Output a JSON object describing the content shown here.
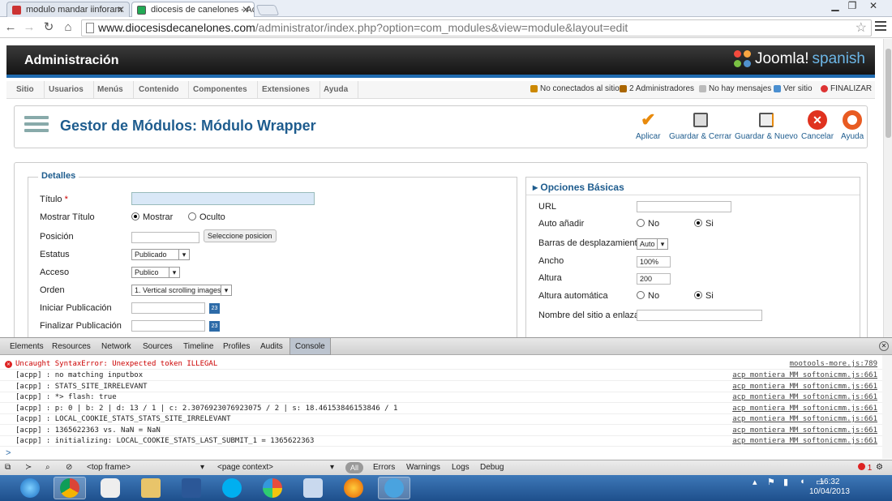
{
  "browser": {
    "tabs": [
      {
        "title": "modulo mandar iinforam"
      },
      {
        "title": "diocesis de canelones - Ac"
      }
    ],
    "url_host": "www.diocesisdecanelones.com",
    "url_path": "/administrator/index.php?option=com_modules&view=module&layout=edit"
  },
  "header": {
    "title": "Administración",
    "brand_joomla": "Joomla!",
    "brand_spanish": "spanish"
  },
  "menu": [
    "Sitio",
    "Usuarios",
    "Menús",
    "Contenido",
    "Componentes",
    "Extensiones",
    "Ayuda"
  ],
  "status": [
    "No conectados al sitio",
    "2 Administradores",
    "No hay mensajes",
    "Ver sitio",
    "FINALIZAR"
  ],
  "page": {
    "title": "Gestor de Módulos: Módulo Wrapper"
  },
  "toolbar": [
    "Aplicar",
    "Guardar & Cerrar",
    "Guardar & Nuevo",
    "Cancelar",
    "Ayuda"
  ],
  "details": {
    "legend": "Detalles",
    "title_label": "Título",
    "required": "*",
    "show_title_label": "Mostrar Título",
    "show": "Mostrar",
    "hidden": "Oculto",
    "position_label": "Posición",
    "position_button": "Seleccione posicion",
    "status_label": "Estatus",
    "status_value": "Publicado",
    "access_label": "Acceso",
    "access_value": "Publico",
    "order_label": "Orden",
    "order_value": "1. Vertical scrolling images",
    "start_label": "Iniciar Publicación",
    "end_label": "Finalizar Publicación",
    "cal_icon": "23"
  },
  "options": {
    "heading": "Opciones Básicas",
    "url_label": "URL",
    "auto_add_label": "Auto añadir",
    "no": "No",
    "yes": "Si",
    "scroll_label": "Barras de desplazamiento",
    "scroll_value": "Auto",
    "width_label": "Ancho",
    "width_value": "100%",
    "height_label": "Altura",
    "height_value": "200",
    "auto_height_label": "Altura automática",
    "site_name_label": "Nombre del sitio a enlazar"
  },
  "devtools": {
    "tabs": [
      "Elements",
      "Resources",
      "Network",
      "Sources",
      "Timeline",
      "Profiles",
      "Audits",
      "Console"
    ],
    "log": [
      {
        "msg": "Uncaught SyntaxError: Unexpected token ILLEGAL",
        "src": "mootools-more.js:789",
        "error": true
      },
      {
        "msg": "[acpp] : no matching inputbox",
        "src": "acp_montiera_MM_softonicmm.js:661"
      },
      {
        "msg": "[acpp] : STATS_SITE_IRRELEVANT",
        "src": "acp_montiera_MM_softonicmm.js:661"
      },
      {
        "msg": "[acpp] : *> flash: true",
        "src": "acp_montiera_MM_softonicmm.js:661"
      },
      {
        "msg": "[acpp] : p: 0 | b: 2 | d: 13 / 1 | c: 2.3076923076923075 / 2 | s: 18.46153846153846 / 1",
        "src": "acp_montiera_MM_softonicmm.js:661"
      },
      {
        "msg": "[acpp] : LOCAL_COOKIE_STATS_STATS_SITE_IRRELEVANT",
        "src": "acp_montiera_MM_softonicmm.js:661"
      },
      {
        "msg": "[acpp] : 1365622363 vs. NaN = NaN",
        "src": "acp_montiera_MM_softonicmm.js:661"
      },
      {
        "msg": "[acpp] : initializing: LOCAL_COOKIE_STATS_LAST_SUBMIT_1 = 1365622363",
        "src": "acp_montiera_MM_softonicmm.js:661"
      }
    ],
    "prompt": ">",
    "footer": {
      "frame": "<top frame>",
      "context": "<page context>",
      "all": "All",
      "errors": "Errors",
      "warnings": "Warnings",
      "logs": "Logs",
      "debug": "Debug",
      "error_count": "1"
    }
  },
  "taskbar": {
    "time": "16:32",
    "date": "10/04/2013"
  }
}
